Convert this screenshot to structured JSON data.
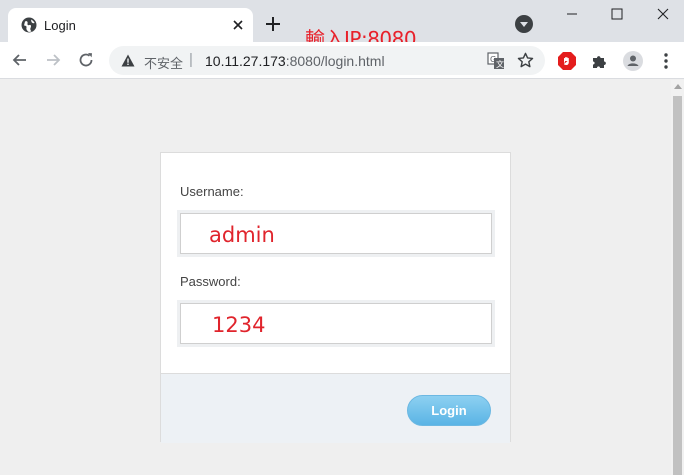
{
  "browser": {
    "tab_title": "Login",
    "annotation": "輸入IP:8080",
    "security_label": "不安全",
    "url_host": "10.11.27.173",
    "url_rest": ":8080/login.html"
  },
  "form": {
    "username_label": "Username:",
    "username_value": "admin",
    "password_label": "Password:",
    "password_value": "1234",
    "login_label": "Login"
  },
  "colors": {
    "annotation": "#e8202a",
    "button": "#5ab4e5",
    "adblock": "#e41d1d"
  }
}
